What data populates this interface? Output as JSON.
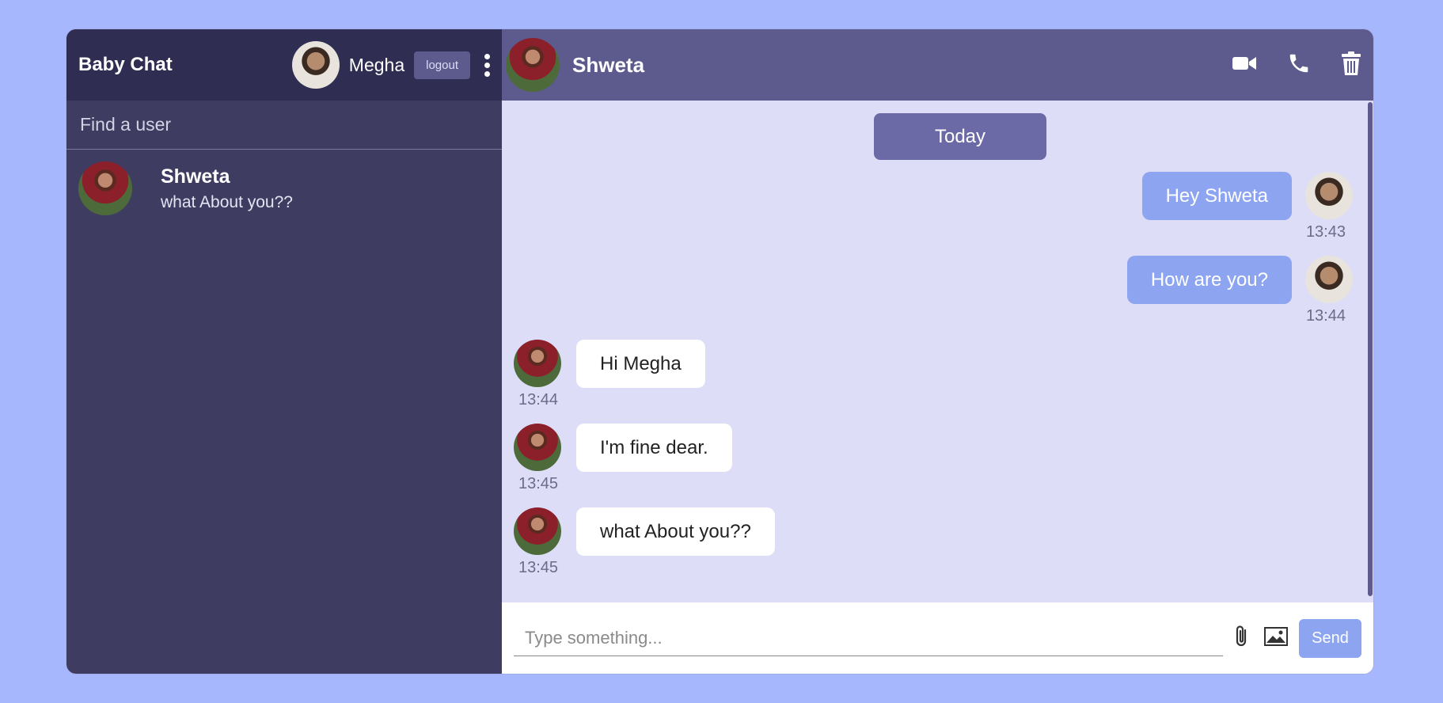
{
  "sidebar": {
    "brand": "Baby Chat",
    "current_user": "Megha",
    "logout_label": "logout",
    "search_placeholder": "Find a user",
    "chats": [
      {
        "name": "Shweta",
        "last_message": "what About you??"
      }
    ]
  },
  "chat": {
    "contact_name": "Shweta",
    "date_label": "Today",
    "messages": [
      {
        "text": "Hey Shweta",
        "time": "13:43",
        "owner": true
      },
      {
        "text": "How are you?",
        "time": "13:44",
        "owner": true
      },
      {
        "text": "Hi Megha",
        "time": "13:44",
        "owner": false
      },
      {
        "text": "I'm fine dear.",
        "time": "13:45",
        "owner": false
      },
      {
        "text": "what About you??",
        "time": "13:45",
        "owner": false
      }
    ],
    "input_placeholder": "Type something...",
    "send_label": "Send"
  },
  "icons": [
    "video-camera-icon",
    "phone-icon",
    "trash-icon",
    "paperclip-icon",
    "image-icon",
    "more-vertical-icon"
  ],
  "colors": {
    "background": "#a7b7fd",
    "sidebar": "#3e3c61",
    "sidebar_nav": "#2f2d52",
    "chat_header": "#5d5b8d",
    "chat_bg": "#ddddf7",
    "owner_bubble": "#8da4f1",
    "date_pill": "#6c6aa6"
  }
}
